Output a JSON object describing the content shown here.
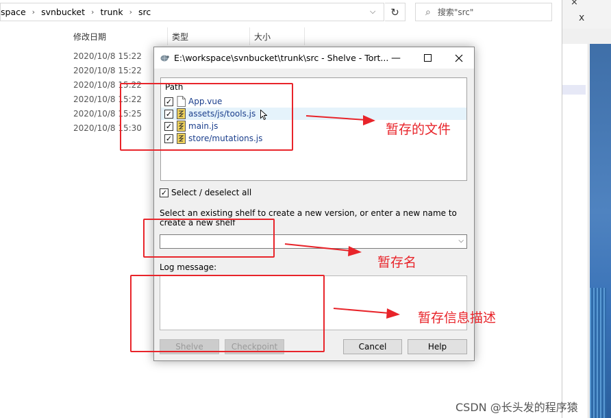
{
  "explorer": {
    "breadcrumbs": [
      "space",
      "svnbucket",
      "trunk",
      "src"
    ],
    "search_placeholder": "搜索\"src\"",
    "columns": [
      "修改日期",
      "类型",
      "大小"
    ],
    "dates": [
      "2020/10/8 15:22",
      "2020/10/8 15:22",
      "2020/10/8 15:22",
      "2020/10/8 15:22",
      "2020/10/8 15:25",
      "2020/10/8 15:30"
    ]
  },
  "right_window": {
    "close_glyph": "x"
  },
  "dialog": {
    "title": "E:\\workspace\\svnbucket\\trunk\\src - Shelve - Tort...",
    "list_header": "Path",
    "files": [
      {
        "name": "App.vue",
        "checked": true,
        "icon": "plain-file-icon"
      },
      {
        "name": "assets/js/tools.js",
        "checked": true,
        "icon": "modified-file-icon"
      },
      {
        "name": "main.js",
        "checked": true,
        "icon": "modified-file-icon"
      },
      {
        "name": "store/mutations.js",
        "checked": true,
        "icon": "modified-file-icon"
      }
    ],
    "select_all_label": "Select / deselect all",
    "shelf_description": "Select an existing shelf to create a new version, or enter a new name to create a new shelf",
    "shelf_value": "",
    "log_label": "Log message:",
    "log_value": "",
    "buttons": {
      "shelve": "Shelve",
      "checkpoint": "Checkpoint",
      "cancel": "Cancel",
      "help": "Help"
    }
  },
  "annotations": {
    "files_note": "暂存的文件",
    "name_note": "暂存名",
    "desc_note": "暂存信息描述",
    "accent_color": "#e8242a"
  },
  "watermark": "CSDN @长头发的程序猿"
}
